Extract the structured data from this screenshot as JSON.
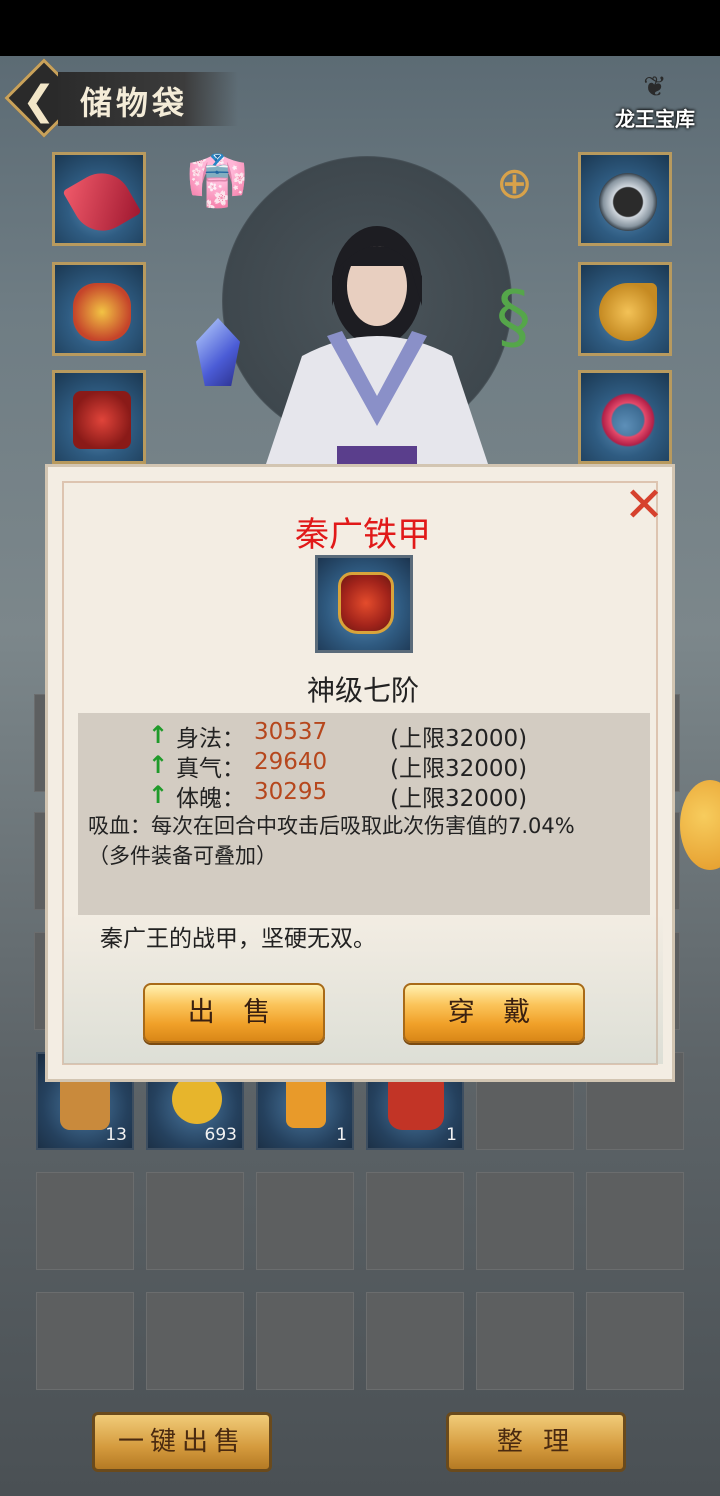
{
  "header": {
    "title": "储物袋",
    "treasury_label": "龙王宝库"
  },
  "inventory": {
    "counts": [
      "13",
      "693",
      "1",
      "1"
    ]
  },
  "bottom_bar": {
    "sell_all_label": "一键出售",
    "sort_label": "整 理"
  },
  "item_detail": {
    "name": "秦广铁甲",
    "grade": "神级七阶",
    "stats": [
      {
        "name": "身法：",
        "value": "30537",
        "cap": "(上限32000)"
      },
      {
        "name": "真气：",
        "value": "29640",
        "cap": "(上限32000)"
      },
      {
        "name": "体魄：",
        "value": "30295",
        "cap": "(上限32000)"
      }
    ],
    "effect": "吸血：每次在回合中攻击后吸取此次伤害值的7.04%（多件装备可叠加）",
    "description": "秦广王的战甲，坚硬无双。",
    "sell_label": "出 售",
    "equip_label": "穿 戴"
  },
  "colors": {
    "name_red": "#e11919",
    "value_orange": "#b6471d",
    "arrow_green": "#1f9a2a"
  }
}
